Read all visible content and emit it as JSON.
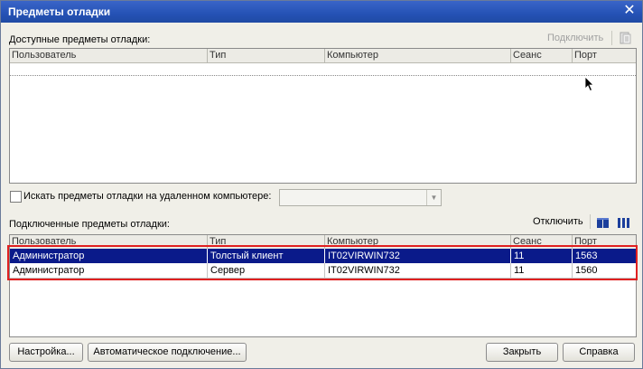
{
  "window": {
    "title": "Предметы отладки",
    "close_glyph": "✕"
  },
  "available": {
    "label": "Доступные предметы отладки:",
    "connect_label": "Подключить",
    "columns": [
      "Пользователь",
      "Тип",
      "Компьютер",
      "Сеанс",
      "Порт"
    ]
  },
  "remote_search": {
    "label": "Искать предметы отладки на удаленном компьютере:",
    "checked": false,
    "value": ""
  },
  "connected": {
    "label": "Подключенные предметы отладки:",
    "disconnect_label": "Отключить",
    "columns": [
      "Пользователь",
      "Тип",
      "Компьютер",
      "Сеанс",
      "Порт"
    ],
    "rows": [
      {
        "user": "Администратор",
        "type": "Толстый клиент",
        "computer": "IT02VIRWIN732",
        "session": "11",
        "port": "1563"
      },
      {
        "user": "Администратор",
        "type": "Сервер",
        "computer": "IT02VIRWIN732",
        "session": "11",
        "port": "1560"
      }
    ]
  },
  "buttons": {
    "settings": "Настройка...",
    "auto_connect": "Автоматическое подключение...",
    "close": "Закрыть",
    "help": "Справка"
  },
  "colors": {
    "selection": "#0a1a8a",
    "highlight": "#e02020",
    "titlebar": "#2552b5"
  }
}
